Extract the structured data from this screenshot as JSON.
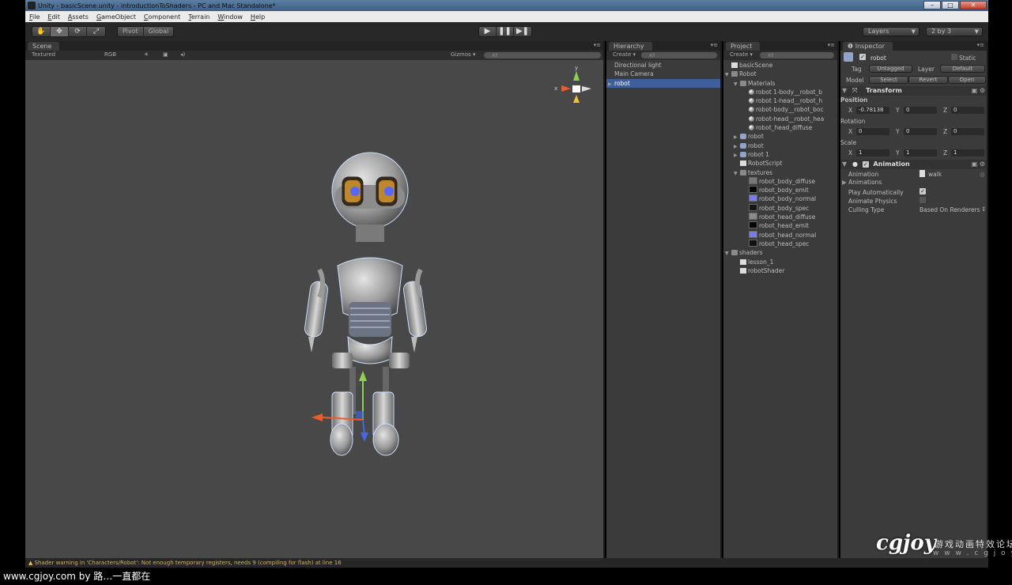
{
  "window": {
    "title": "Unity - basicScene.unity - introductionToShaders - PC and Mac Standalone*",
    "min": "–",
    "max": "□",
    "close": "✕"
  },
  "menu": [
    "File",
    "Edit",
    "Assets",
    "GameObject",
    "Component",
    "Terrain",
    "Window",
    "Help"
  ],
  "toolbar": {
    "tools": [
      "✋",
      "✥",
      "⟳",
      "⤢"
    ],
    "pivot": "Pivot",
    "global": "Global",
    "play": "▶",
    "pause": "❚❚",
    "step": "▶❚",
    "layers": "Layers",
    "layout": "2 by 3"
  },
  "scene": {
    "tab": "Scene",
    "shading": "Textured",
    "render_mode": "RGB",
    "gizmos": "Gizmos ▾",
    "search": "All",
    "axis_y": "y",
    "axis_x": "x"
  },
  "hierarchy": {
    "tab": "Hierarchy",
    "create": "Create ▾",
    "search": "All",
    "items": [
      "Directional light",
      "Main Camera",
      "robot"
    ],
    "selected": 2
  },
  "project": {
    "tab": "Project",
    "create": "Create ▾",
    "search": "All",
    "items": [
      {
        "label": "basicScene",
        "indent": 0,
        "icon": "unity-scene-icon",
        "tri": ""
      },
      {
        "label": "Robot",
        "indent": 0,
        "icon": "folder-icon",
        "tri": "▼"
      },
      {
        "label": "Materials",
        "indent": 1,
        "icon": "folder-icon",
        "tri": "▼"
      },
      {
        "label": "robot 1-body__robot_b",
        "indent": 2,
        "icon": "material-sphere-icon",
        "tri": ""
      },
      {
        "label": "robot 1-head__robot_h",
        "indent": 2,
        "icon": "material-sphere-icon",
        "tri": ""
      },
      {
        "label": "robot-body__robot_boc",
        "indent": 2,
        "icon": "material-sphere-icon",
        "tri": ""
      },
      {
        "label": "robot-head__robot_hea",
        "indent": 2,
        "icon": "material-sphere-icon",
        "tri": ""
      },
      {
        "label": "robot_head_diffuse",
        "indent": 2,
        "icon": "material-sphere-icon",
        "tri": ""
      },
      {
        "label": "robot",
        "indent": 1,
        "icon": "mesh-icon",
        "tri": "▶"
      },
      {
        "label": "robot",
        "indent": 1,
        "icon": "mesh-icon",
        "tri": "▶"
      },
      {
        "label": "robot 1",
        "indent": 1,
        "icon": "mesh-icon",
        "tri": "▶"
      },
      {
        "label": "RobotScript",
        "indent": 1,
        "icon": "script-icon",
        "tri": ""
      },
      {
        "label": "textures",
        "indent": 1,
        "icon": "folder-icon",
        "tri": "▼"
      },
      {
        "label": "robot_body_diffuse",
        "indent": 2,
        "icon": "texture-icon",
        "tri": "",
        "swatch": "#777777"
      },
      {
        "label": "robot_body_emit",
        "indent": 2,
        "icon": "texture-icon",
        "tri": "",
        "swatch": "#050505"
      },
      {
        "label": "robot_body_normal",
        "indent": 2,
        "icon": "texture-icon",
        "tri": "",
        "swatch": "#7b7bf0"
      },
      {
        "label": "robot_body_spec",
        "indent": 2,
        "icon": "texture-icon",
        "tri": "",
        "swatch": "#151515"
      },
      {
        "label": "robot_head_diffuse",
        "indent": 2,
        "icon": "texture-icon",
        "tri": "",
        "swatch": "#8a8a8a"
      },
      {
        "label": "robot_head_emit",
        "indent": 2,
        "icon": "texture-icon",
        "tri": "",
        "swatch": "#050505"
      },
      {
        "label": "robot_head_normal",
        "indent": 2,
        "icon": "texture-icon",
        "tri": "",
        "swatch": "#7b7bf0"
      },
      {
        "label": "robot_head_spec",
        "indent": 2,
        "icon": "texture-icon",
        "tri": "",
        "swatch": "#111111"
      },
      {
        "label": "shaders",
        "indent": 0,
        "icon": "folder-icon",
        "tri": "▼"
      },
      {
        "label": "lesson_1",
        "indent": 1,
        "icon": "shader-icon",
        "tri": ""
      },
      {
        "label": "robotShader",
        "indent": 1,
        "icon": "shader-icon",
        "tri": ""
      }
    ]
  },
  "inspector": {
    "tab": "Inspector",
    "object_name": "robot",
    "static": "Static",
    "tag_label": "Tag",
    "tag_value": "Untagged",
    "layer_label": "Layer",
    "layer_value": "Default",
    "model_label": "Model",
    "select": "Select",
    "revert": "Revert",
    "open": "Open",
    "transform": {
      "title": "Transform",
      "position_label": "Position",
      "rotation_label": "Rotation",
      "scale_label": "Scale",
      "pos": {
        "x": "-0.78138",
        "y": "0",
        "z": "0"
      },
      "rot": {
        "x": "0",
        "y": "0",
        "z": "0"
      },
      "scale": {
        "x": "1",
        "y": "1",
        "z": "1"
      }
    },
    "animation": {
      "title": "Animation",
      "animation_label": "Animation",
      "animation_value": "walk",
      "animations_label": "Animations",
      "play_auto_label": "Play Automatically",
      "play_auto": true,
      "physics_label": "Animate Physics",
      "physics": false,
      "culling_label": "Culling Type",
      "culling_value": "Based On Renderers"
    }
  },
  "status": "Shader warning in 'Characters/Robot': Not enough temporary registers, needs 9 (compiling for flash) at line 16",
  "watermark": {
    "bottom": "www.cgjoy.com by 路…一直都在",
    "logo": "cgjoy",
    "logo_cn": "游戏动画特效论坛",
    "logo_url": "w w w . c g j o y . c o m"
  }
}
